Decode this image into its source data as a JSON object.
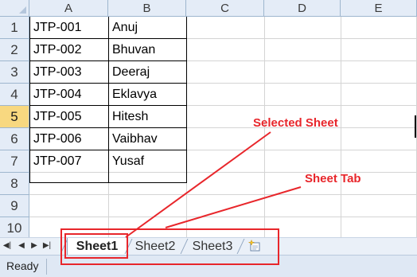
{
  "columns": [
    "A",
    "B",
    "C",
    "D",
    "E"
  ],
  "rows": [
    "1",
    "2",
    "3",
    "4",
    "5",
    "6",
    "7",
    "8",
    "9",
    "10"
  ],
  "selected_row": "5",
  "cells": [
    {
      "id": "JTP-001",
      "name": "Anuj"
    },
    {
      "id": "JTP-002",
      "name": "Bhuvan"
    },
    {
      "id": "JTP-003",
      "name": "Deeraj"
    },
    {
      "id": "JTP-004",
      "name": "Eklavya"
    },
    {
      "id": "JTP-005",
      "name": "Hitesh"
    },
    {
      "id": "JTP-006",
      "name": "Vaibhav"
    },
    {
      "id": "JTP-007",
      "name": "Yusaf"
    }
  ],
  "sheet_tabs": [
    {
      "label": "Sheet1",
      "active": true
    },
    {
      "label": "Sheet2",
      "active": false
    },
    {
      "label": "Sheet3",
      "active": false
    }
  ],
  "nav_icons": [
    "first-sheet-icon",
    "prev-sheet-icon",
    "next-sheet-icon",
    "last-sheet-icon"
  ],
  "status": {
    "text": "Ready"
  },
  "annotations": {
    "selected_sheet": "Selected Sheet",
    "sheet_tab": "Sheet Tab",
    "color": "#e8262b"
  },
  "colors": {
    "header_bg": "#e4ecf7",
    "selected_header_bg": "#f8d880",
    "gridline": "#d4d4d4"
  }
}
